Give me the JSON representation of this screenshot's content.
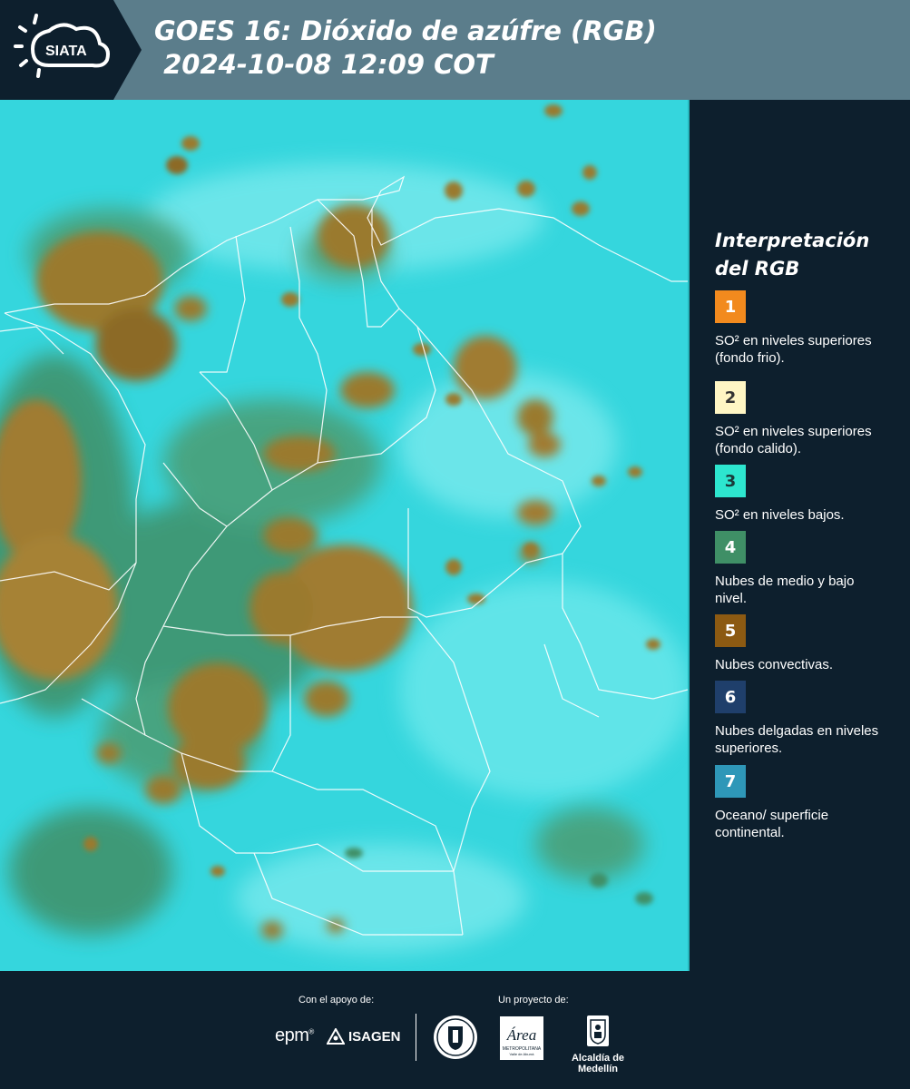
{
  "header": {
    "logo_text": "SIATA",
    "title_line1": "GOES 16: Dióxido de azúfre (RGB)",
    "title_line2": " 2024-10-08 12:09 COT"
  },
  "legend": {
    "title_line1": "Interpretación",
    "title_line2": "del RGB",
    "items": [
      {
        "number": "1",
        "color": "#f28a1e",
        "text_color": "#ffffff",
        "label": "SO² en niveles superiores (fondo frio)."
      },
      {
        "number": "2",
        "color": "#fff6c4",
        "text_color": "#333333",
        "label": "SO² en niveles superiores (fondo calido)."
      },
      {
        "number": "3",
        "color": "#2de6cf",
        "text_color": "#1a3a3a",
        "label": "SO² en niveles bajos."
      },
      {
        "number": "4",
        "color": "#3f8f66",
        "text_color": "#ffffff",
        "label": "Nubes de medio y bajo nivel."
      },
      {
        "number": "5",
        "color": "#8c5a12",
        "text_color": "#ffffff",
        "label": "Nubes convectivas."
      },
      {
        "number": "6",
        "color": "#1f3f6b",
        "text_color": "#ffffff",
        "label": "Nubes delgadas en niveles superiores."
      },
      {
        "number": "7",
        "color": "#2e97b8",
        "text_color": "#ffffff",
        "label": "Oceano/ superficie continental."
      }
    ]
  },
  "footer": {
    "support_label": "Con el apoyo de:",
    "project_label": "Un proyecto de:",
    "epm_logo": "epm",
    "isagen_logo": "ISAGEN",
    "area_logo": "Área",
    "area_subtitle": "METROPOLITANA",
    "area_subtitle2": "Valle de Aburrá",
    "alcaldia_label": "Alcaldía de Medellín"
  },
  "colors": {
    "background": "#0d1f2d",
    "header_band": "#5b7d8b",
    "sky_cyan": "#35d6dd",
    "cloud_green": "#3f8f66",
    "cloud_brown": "#9a7a2e"
  }
}
